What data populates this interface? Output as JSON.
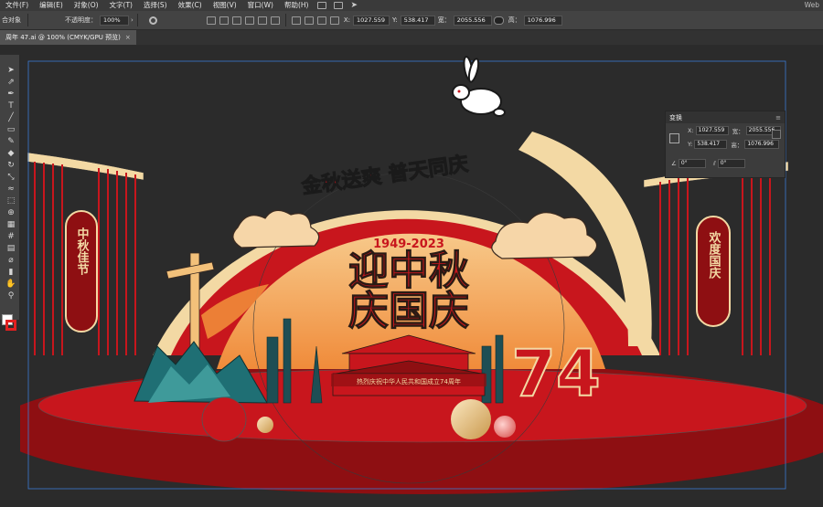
{
  "menu": [
    "文件(F)",
    "编辑(E)",
    "对象(O)",
    "文字(T)",
    "选择(S)",
    "效果(C)",
    "视图(V)",
    "窗口(W)",
    "帮助(H)"
  ],
  "workspace": "Web",
  "control": {
    "selection": "编组",
    "selection_short": "合对象",
    "opacity_label": "不透明度：",
    "opacity_value": "100%",
    "x_label": "X:",
    "x_value": "1027.559",
    "y_label": "Y:",
    "y_value": "538.417",
    "w_label": "宽：",
    "w_value": "2055.556",
    "h_label": "高：",
    "h_value": "1076.996"
  },
  "document_tab": {
    "title": "周年 47.ai @ 100% (CMYK/GPU 预览)",
    "close": "×"
  },
  "transform_panel": {
    "title": "变换",
    "x_label": "X:",
    "x": "1027.559",
    "w_label": "宽：",
    "w": "2055.556",
    "y_label": "Y:",
    "y": "538.417",
    "h_label": "高：",
    "h": "1076.996",
    "angle": "0°",
    "shear": "0°"
  },
  "artwork": {
    "top_slogan": "金秋送爽 普天同庆",
    "date_badge": "1949-2023",
    "headline_1": "迎中秋",
    "headline_2": "庆国庆",
    "big_number": "74",
    "left_column": "中秋佳节",
    "right_column": "欢度国庆",
    "stage_caption": "热烈庆祝中华人民共和国成立74周年",
    "colors": {
      "red": "#c8161d",
      "dark_red": "#8e0f12",
      "cream": "#f3d9a4",
      "orange": "#f5a24a",
      "teal": "#1f6f74"
    }
  },
  "icons": {
    "selection_tool": "arrow-icon",
    "direct_selection": "hollow-arrow-icon",
    "pen_tool": "pen-icon",
    "type_tool": "type-icon",
    "line_tool": "line-icon",
    "rectangle_tool": "rectangle-icon",
    "brush_tool": "brush-icon",
    "pencil_tool": "pencil-icon",
    "eraser_tool": "eraser-icon",
    "rotate_tool": "rotate-icon",
    "scale_tool": "scale-icon",
    "warp_tool": "warp-icon",
    "free_transform": "free-transform-icon",
    "shape_builder": "shape-builder-icon",
    "perspective_grid": "perspective-icon",
    "mesh_tool": "mesh-icon",
    "gradient_tool": "gradient-icon",
    "eyedropper_tool": "eyedropper-icon",
    "blend_tool": "blend-icon",
    "symbol_sprayer": "symbol-icon",
    "graph_tool": "graph-icon",
    "artboard_tool": "artboard-icon",
    "hand_tool": "hand-icon",
    "zoom_tool": "zoom-icon"
  }
}
